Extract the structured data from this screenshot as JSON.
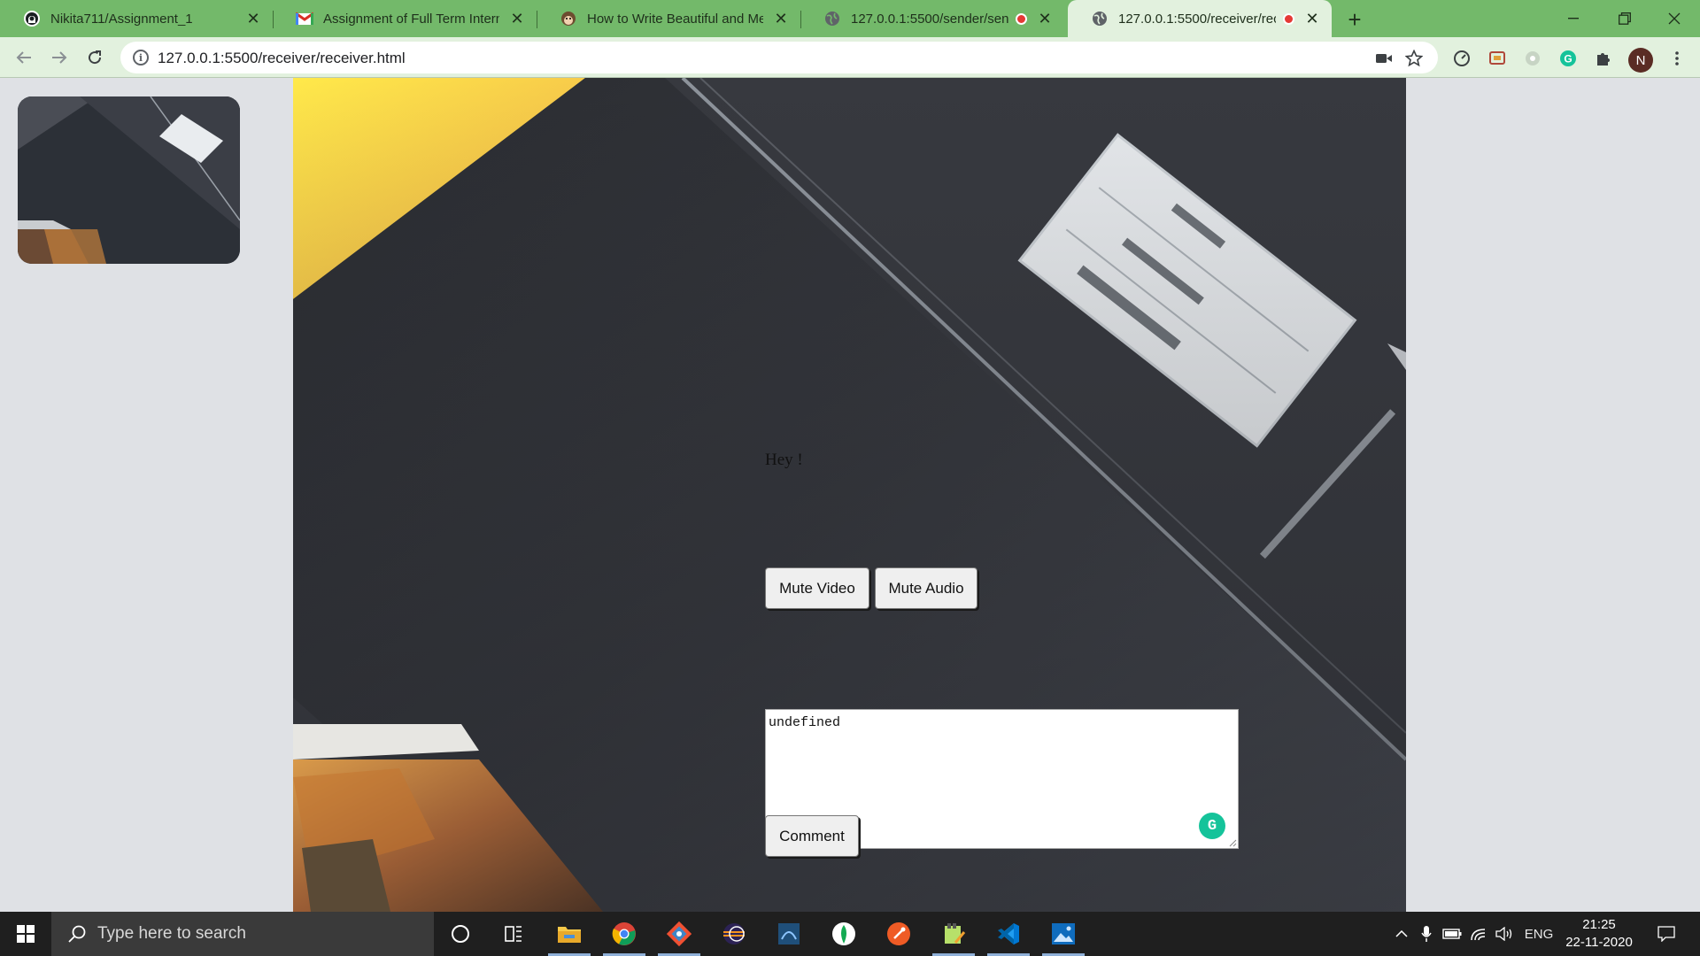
{
  "browser": {
    "tabs": [
      {
        "title": "Nikita711/Assignment_1",
        "favicon": "github-icon",
        "recording": false
      },
      {
        "title": "Assignment of Full Term Internsh",
        "favicon": "gmail-icon",
        "recording": false
      },
      {
        "title": "How to Write Beautiful and Mean",
        "favicon": "monkey-icon",
        "recording": false
      },
      {
        "title": "127.0.0.1:5500/sender/sende",
        "favicon": "globe-icon",
        "recording": true
      },
      {
        "title": "127.0.0.1:5500/receiver/rece",
        "favicon": "globe-icon",
        "recording": true,
        "active": true
      }
    ],
    "url": "127.0.0.1:5500/receiver/receiver.html",
    "profile_initial": "N",
    "colors": {
      "frame": "#73b96a",
      "toolbar": "#e2f1de"
    }
  },
  "page": {
    "message": "Hey !",
    "mute_video_label": "Mute Video",
    "mute_audio_label": "Mute Audio",
    "comment_value": "undefined",
    "comment_button_label": "Comment"
  },
  "taskbar": {
    "search_placeholder": "Type here to search",
    "language": "ENG",
    "time": "21:25",
    "date": "22-11-2020",
    "pinned_apps": [
      "cortana-icon",
      "task-view-icon",
      "file-explorer-icon",
      "chrome-icon",
      "git-icon",
      "eclipse-icon",
      "sts-icon",
      "mongodb-compass-icon",
      "postman-icon",
      "notepad-plus-plus-icon",
      "vscode-icon",
      "photos-icon"
    ]
  }
}
